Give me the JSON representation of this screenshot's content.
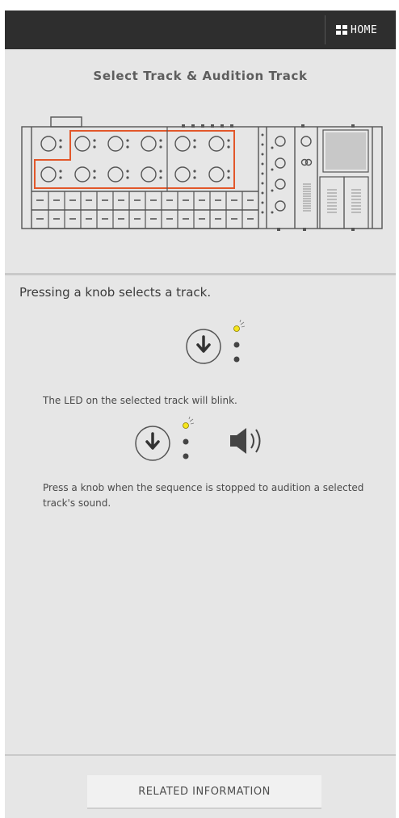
{
  "header": {
    "home_label": "HOME"
  },
  "hero": {
    "title": "Select Track & Audition Track"
  },
  "content": {
    "intro": "Pressing a knob selects a track.",
    "led_note": "The LED on the selected track will blink.",
    "audition_note": "Press a knob when the sequence is stopped to audition a selected track's sound."
  },
  "footer": {
    "related_label": "RELATED INFORMATION"
  },
  "colors": {
    "topbar": "#2e2e2e",
    "background": "#e6e6e6",
    "highlight": "#e2572a",
    "led": "#f5e51c"
  },
  "icons": [
    "home-grid-icon",
    "knob-press-icon",
    "led-blink-icon",
    "speaker-icon"
  ]
}
